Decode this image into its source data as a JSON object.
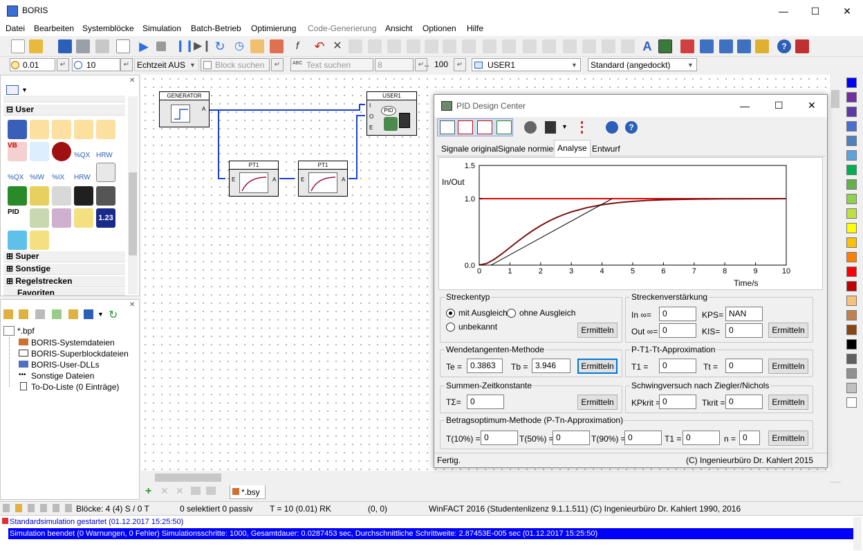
{
  "app": {
    "title": "BORIS"
  },
  "menu": [
    "Datei",
    "Bearbeiten",
    "Systemblöcke",
    "Simulation",
    "Batch-Betrieb",
    "Optimierung",
    "Code-Generierung",
    "Ansicht",
    "Optionen",
    "Hilfe"
  ],
  "toolbar2": {
    "step": "0.01",
    "time": "10",
    "realtime": "Echtzeit AUS",
    "block_search": "Block suchen",
    "text_search": "Text suchen",
    "text_search_num": "8",
    "zoom": "100",
    "block_select": "USER1",
    "layout_select": "Standard (angedockt)"
  },
  "library": {
    "sections": {
      "user": "User",
      "super": "Super",
      "sonstige": "Sonstige",
      "regelstrecken": "Regelstrecken",
      "favoriten": "Favoriten"
    },
    "icon_labels": [
      "%QX",
      "%IW",
      "%IX",
      "HRW",
      "%QX",
      "HRW",
      "PID",
      "1.23",
      "VB"
    ]
  },
  "project": {
    "root": "*.bpf",
    "items": [
      "BORIS-Systemdateien",
      "BORIS-Superblockdateien",
      "BORIS-User-DLLs",
      "Sonstige Dateien",
      "To-Do-Liste (0 Einträge)"
    ]
  },
  "canvas": {
    "blocks": [
      {
        "title": "GENERATOR",
        "port_out": "A"
      },
      {
        "title": "PT1",
        "port_in": "E",
        "port_out": "A"
      },
      {
        "title": "PT1",
        "port_in": "E",
        "port_out": "A"
      },
      {
        "title": "USER1",
        "port_i": "I",
        "port_o": "O",
        "port_e": "E",
        "icon": "PID"
      }
    ]
  },
  "bottom_tab": "*.bsy",
  "status": {
    "blocks": "Blöcke: 4 (4) S / 0 T",
    "selected": "0 selektiert  0 passiv",
    "t": "T = 10  (0.01)  RK",
    "coords": "(0, 0)",
    "license": "WinFACT 2016 (Studentenlizenz 9.1.1.511)  (C) Ingenieurbüro Dr. Kahlert 1990, 2016"
  },
  "log": [
    "Standardsimulation gestartet   (01.12.2017 15:25:50)",
    "Simulation beendet (0 Warnungen, 0 Fehler)   Simulationsschritte: 1000, Gesamtdauer:  0.0287453 sec, Durchschnittliche Schrittweite: 2.87453E-005 sec   (01.12.2017 15:25:50)"
  ],
  "colors": {
    "accent": "#0000ff",
    "signal": "#e00000",
    "response": "#7a1010"
  },
  "palette": [
    "#0000ff",
    "#7030a0",
    "#5b3aa6",
    "#4a6fd0",
    "#4f81bd",
    "#5ba3d8",
    "#00b050",
    "#66b04a",
    "#92d050",
    "#c0e040",
    "#ffff00",
    "#ffc000",
    "#ff8000",
    "#ff0000",
    "#c00000",
    "#f4c27a",
    "#c08050",
    "#8b4513",
    "#000000",
    "#606060",
    "#909090",
    "#c0c0c0",
    "#ffffff"
  ],
  "pid": {
    "title": "PID Design Center",
    "tabs": [
      "Signale original",
      "Signale normiert",
      "Analyse",
      "Entwurf"
    ],
    "active_tab": "Analyse",
    "streckentyp": {
      "title": "Streckentyp",
      "opt1": "mit Ausgleich",
      "opt2": "ohne Ausgleich",
      "opt3": "unbekannt",
      "button": "Ermitteln"
    },
    "verstaerkung": {
      "title": "Streckenverstärkung",
      "in_label": "In ∞=",
      "in_val": "0",
      "out_label": "Out ∞=",
      "out_val": "0",
      "kps_label": "KPS=",
      "kps_val": "NAN",
      "kis_label": "KIS=",
      "kis_val": "0",
      "button": "Ermitteln"
    },
    "wendetangente": {
      "title": "Wendetangenten-Methode",
      "te_label": "Te =",
      "te_val": "0.3863",
      "tb_label": "Tb =",
      "tb_val": "3.946",
      "button": "Ermitteln"
    },
    "pt1tt": {
      "title": "P-T1-Tt-Approximation",
      "t1_label": "T1 =",
      "t1_val": "0",
      "tt_label": "Tt =",
      "tt_val": "0",
      "button": "Ermitteln"
    },
    "summen": {
      "title": "Summen-Zeitkonstante",
      "label": "TΣ=",
      "val": "0",
      "button": "Ermitteln"
    },
    "ziegler": {
      "title": "Schwingversuch nach Ziegler/Nichols",
      "kp_label": "KPkrit =",
      "kp_val": "0",
      "tk_label": "Tkrit =",
      "tk_val": "0",
      "button": "Ermitteln"
    },
    "betrag": {
      "title": "Betragsoptimum-Methode (P-Tn-Approximation)",
      "t10_label": "T(10%) =",
      "t10_val": "0",
      "t50_label": "T(50%) =",
      "t50_val": "0",
      "t90_label": "T(90%) =",
      "t90_val": "0",
      "t1_label": "T1 =",
      "t1_val": "0",
      "n_label": "n =",
      "n_val": "0",
      "button": "Ermitteln"
    },
    "status_left": "Fertig.",
    "status_right": "(C) Ingenieurbüro Dr. Kahlert 2015"
  },
  "chart_data": {
    "type": "line",
    "ylabel": "In/Out",
    "xlabel": "Time/s",
    "xlim": [
      0,
      10
    ],
    "ylim": [
      0,
      1.5
    ],
    "x_ticks": [
      "0",
      "1",
      "2",
      "3",
      "4",
      "5",
      "6",
      "7",
      "8",
      "9",
      "10"
    ],
    "y_ticks": [
      "0.0",
      "1.0",
      "1.5"
    ],
    "series": [
      {
        "color": "#e00000",
        "x": [
          0,
          10
        ],
        "y": [
          1.0,
          1.0
        ]
      },
      {
        "color": "#7a1010",
        "x": [
          0,
          0.25,
          0.5,
          0.75,
          1,
          1.25,
          1.5,
          1.75,
          2,
          2.25,
          2.5,
          2.75,
          3,
          3.5,
          4,
          4.5,
          5,
          5.5,
          6,
          6.5,
          7,
          7.5,
          8,
          8.5,
          9,
          9.5,
          10
        ],
        "y": [
          0,
          0.0265,
          0.0902,
          0.1733,
          0.2642,
          0.3554,
          0.4422,
          0.5221,
          0.594,
          0.6575,
          0.7127,
          0.7603,
          0.8009,
          0.8641,
          0.9084,
          0.939,
          0.9596,
          0.9734,
          0.9826,
          0.9887,
          0.9927,
          0.9953,
          0.997,
          0.998,
          0.9988,
          0.9992,
          0.9995
        ]
      },
      {
        "color": "#000000",
        "x": [
          0.3863,
          4.3323
        ],
        "y": [
          0,
          1.0
        ]
      }
    ]
  }
}
